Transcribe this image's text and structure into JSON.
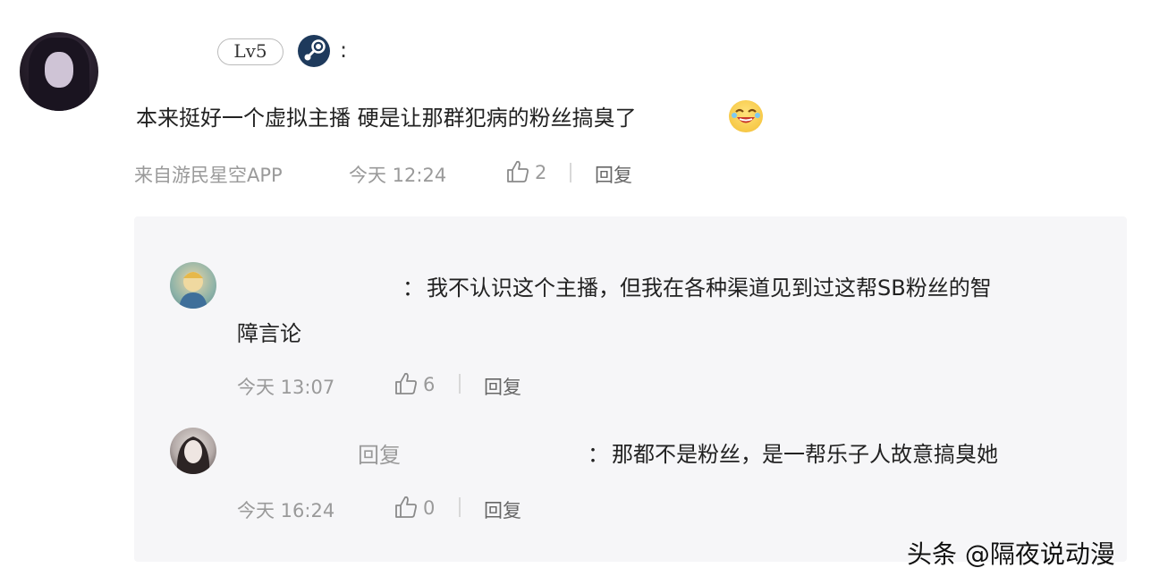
{
  "comment": {
    "level": "Lv5",
    "colon": ":",
    "text": "本来挺好一个虚拟主播 硬是让那群犯病的粉丝搞臭了",
    "source": "来自游民星空APP",
    "time": "今天 12:24",
    "likes": "2",
    "reply_label": "回复"
  },
  "replies": [
    {
      "colon": "：",
      "text_line1": "我不认识这个主播，但我在各种渠道见到过这帮SB粉丝的智",
      "text_line2": "障言论",
      "time": "今天 13:07",
      "likes": "6",
      "reply_label": "回复"
    },
    {
      "reply_to_word": "回复",
      "colon": "：",
      "text": "那都不是粉丝，是一帮乐子人故意搞臭她",
      "time": "今天 16:24",
      "likes": "0",
      "reply_label": "回复"
    }
  ],
  "watermark": "头条 @隔夜说动漫",
  "icons": {
    "like": "thumb-up-icon",
    "platform": "steam-icon",
    "emoji": "laughing-emoji-icon"
  },
  "colors": {
    "meta_text": "#9a9a9a",
    "reply_background": "#f6f6f8",
    "steam_blue": "#1e3a5c"
  }
}
